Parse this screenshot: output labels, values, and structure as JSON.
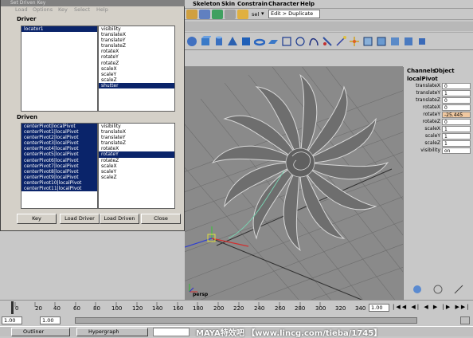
{
  "maya": {
    "menus": [
      "Skeleton",
      "Skin",
      "Constrain",
      "Character",
      "Help"
    ],
    "status_line": {
      "selection_mode": "sel",
      "input_field": "Edit > Duplicate"
    },
    "viewport_label": "persp",
    "channel_box": {
      "tabs": [
        "Channels",
        "Object"
      ],
      "node": "localPivot",
      "attributes": [
        {
          "label": "translateX",
          "value": "0"
        },
        {
          "label": "translateY",
          "value": "1"
        },
        {
          "label": "translateZ",
          "value": "0"
        },
        {
          "label": "rotateX",
          "value": "0"
        },
        {
          "label": "rotateY",
          "value": "-25.445"
        },
        {
          "label": "rotateZ",
          "value": "0"
        },
        {
          "label": "scaleX",
          "value": "1"
        },
        {
          "label": "scaleY",
          "value": "1"
        },
        {
          "label": "scaleZ",
          "value": "1"
        },
        {
          "label": "visibility",
          "value": "on"
        }
      ],
      "highlight_color": "#f0c8a0"
    },
    "timeline": {
      "ticks": [
        "0",
        "20",
        "40",
        "60",
        "80",
        "100",
        "120",
        "140",
        "160",
        "180",
        "200",
        "220",
        "240",
        "260",
        "280",
        "300",
        "320",
        "340"
      ],
      "current_frame": "1.00",
      "range_start": "1.00",
      "range_inner": "1.00"
    },
    "taskbar": {
      "outliner": "Outliner",
      "hypergraph": "Hypergraph"
    },
    "watermark": "MAYA特效吧 【www.lincg.com/tieba/1745】"
  },
  "dialog": {
    "title": "Set Driven Key",
    "menus": [
      "Load",
      "Options",
      "Key",
      "Select",
      "Help"
    ],
    "driver_label": "Driver",
    "driver_objects": [
      "locator1"
    ],
    "driver_attributes": [
      "visibility",
      "translateX",
      "translateY",
      "translateZ",
      "rotateX",
      "rotateY",
      "rotateZ",
      "scaleX",
      "scaleY",
      "scaleZ",
      "shutter"
    ],
    "driver_selected_attr": "shutter",
    "driven_label": "Driven",
    "driven_objects": [
      "centerPivot|localPivot",
      "centerPivot1|localPivot",
      "centerPivot2|localPivot",
      "centerPivot3|localPivot",
      "centerPivot4|localPivot",
      "centerPivot5|localPivot",
      "centerPivot6|localPivot",
      "centerPivot7|localPivot",
      "centerPivot8|localPivot",
      "centerPivot9|localPivot",
      "centerPivot10|localPivot",
      "centerPivot11|localPivot"
    ],
    "driven_attributes": [
      "visibility",
      "translateX",
      "translateY",
      "translateZ",
      "rotateX",
      "rotateY",
      "rotateZ",
      "scaleX",
      "scaleY",
      "scaleZ"
    ],
    "driven_selected_attr": "rotateY",
    "buttons": {
      "key": "Key",
      "load_driver": "Load Driver",
      "load_driven": "Load Driven",
      "close": "Close"
    }
  }
}
